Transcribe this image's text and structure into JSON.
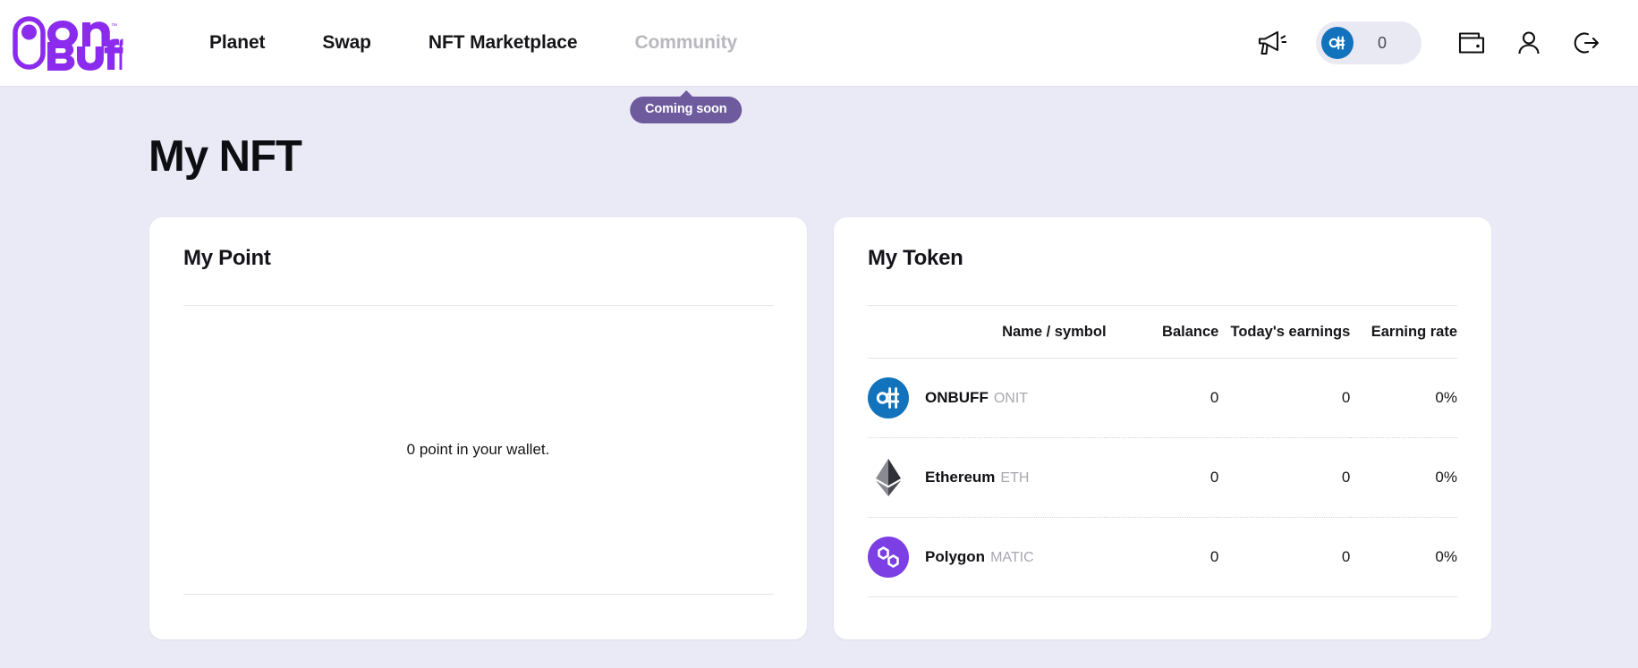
{
  "header": {
    "logo_alt": "ONBUFF",
    "nav": [
      {
        "label": "Planet",
        "disabled": false
      },
      {
        "label": "Swap",
        "disabled": false
      },
      {
        "label": "NFT Marketplace",
        "disabled": false
      },
      {
        "label": "Community",
        "disabled": true,
        "tooltip": "Coming soon"
      }
    ],
    "icons": {
      "announcement": "megaphone-icon",
      "wallet": "wallet-icon",
      "profile": "user-icon",
      "logout": "logout-icon"
    },
    "token_pill": {
      "coin_symbol": "ONIT",
      "balance": "0"
    }
  },
  "page": {
    "title": "My NFT"
  },
  "point_card": {
    "title": "My Point",
    "empty_message": "0 point in your wallet."
  },
  "token_card": {
    "title": "My Token",
    "columns": {
      "name": "Name / symbol",
      "balance": "Balance",
      "today": "Today's earnings",
      "rate": "Earning rate"
    },
    "rows": [
      {
        "icon": "onbuff-coin-icon",
        "name": "ONBUFF",
        "symbol": "ONIT",
        "balance": "0",
        "today": "0",
        "rate": "0%"
      },
      {
        "icon": "ethereum-coin-icon",
        "name": "Ethereum",
        "symbol": "ETH",
        "balance": "0",
        "today": "0",
        "rate": "0%"
      },
      {
        "icon": "polygon-coin-icon",
        "name": "Polygon",
        "symbol": "MATIC",
        "balance": "0",
        "today": "0",
        "rate": "0%"
      }
    ]
  },
  "colors": {
    "brand_purple": "#8b2bed",
    "page_bg": "#eaeaf7",
    "tooltip_bg": "#6d5b9e",
    "onbuff_blue": "#1273bc",
    "polygon_purple": "#7b3fe4",
    "negative_red": "#e8312f",
    "muted_grey": "#a8a8b2"
  }
}
